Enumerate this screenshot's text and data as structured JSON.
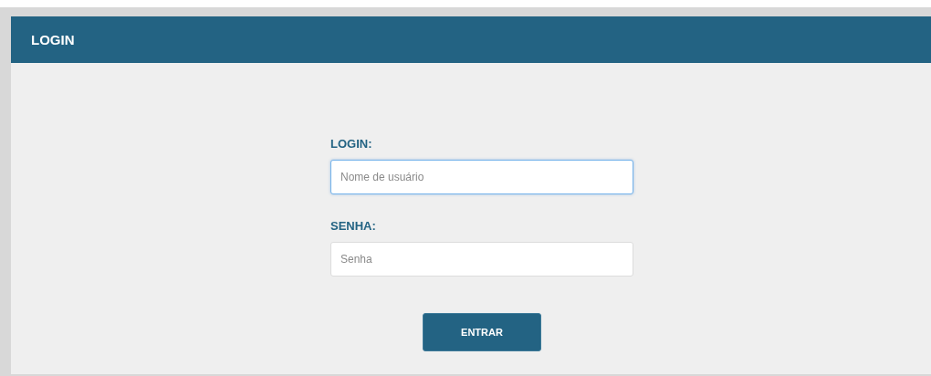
{
  "header": {
    "title": "LOGIN"
  },
  "fields": [
    {
      "label": "LOGIN:",
      "placeholder": "Nome de usuário",
      "focused": true
    },
    {
      "label": "SENHA:",
      "placeholder": "Senha",
      "focused": false
    }
  ],
  "button": {
    "label": "ENTRAR"
  }
}
